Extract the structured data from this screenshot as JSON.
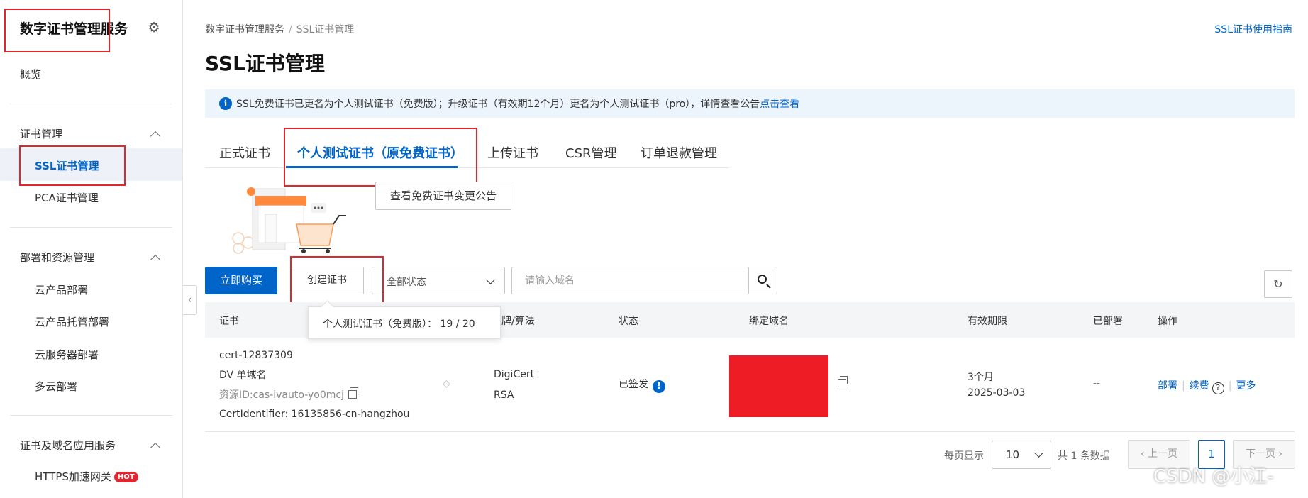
{
  "sidebar": {
    "app_title": "数字证书管理服务",
    "overview": "概览",
    "groups": [
      {
        "title": "证书管理",
        "items": [
          "SSL证书管理",
          "PCA证书管理"
        ]
      },
      {
        "title": "部署和资源管理",
        "items": [
          "云产品部署",
          "云产品托管部署",
          "云服务器部署",
          "多云部署"
        ]
      },
      {
        "title": "证书及域名应用服务",
        "items": [
          "HTTPS加速网关"
        ]
      }
    ],
    "hot_badge": "HOT",
    "active_item": "SSL证书管理"
  },
  "breadcrumb": {
    "root": "数字证书管理服务",
    "sep": "/",
    "current": "SSL证书管理"
  },
  "guide_link": "SSL证书使用指南",
  "page_title": "SSL证书管理",
  "notice": {
    "text": "SSL免费证书已更名为个人测试证书（免费版）；升级证书（有效期12个月）更名为个人测试证书（pro），详情查看公告",
    "link": "点击查看"
  },
  "tabs": [
    "正式证书",
    "个人测试证书（原免费证书）",
    "上传证书",
    "CSR管理",
    "订单退款管理"
  ],
  "active_tab": "个人测试证书（原免费证书）",
  "announce_button": "查看免费证书变更公告",
  "toolbar": {
    "buy": "立即购买",
    "create": "创建证书",
    "status_selected": "全部状态",
    "search_placeholder": "请输入域名"
  },
  "tooltip": "个人测试证书（免费版）：  19 / 20",
  "table": {
    "headers": [
      "证书",
      "品牌/算法",
      "状态",
      "绑定域名",
      "有效期限",
      "已部署",
      "操作"
    ],
    "rows": [
      {
        "cert_id": "cert-12837309",
        "cert_type": "DV 单域名",
        "resource_id": "资源ID:cas-ivauto-yo0mcj",
        "cert_identifier": "CertIdentifier: 16135856-cn-hangzhou",
        "brand": "DigiCert",
        "algorithm": "RSA",
        "status": "已签发",
        "validity": "3个月",
        "expiry": "2025-03-03",
        "deployed": "--",
        "actions": [
          "部署",
          "续费",
          "更多"
        ]
      }
    ]
  },
  "pagination": {
    "per_page_label": "每页显示",
    "per_page": "10",
    "total": "共 1 条数据",
    "prev": "上一页",
    "page": "1",
    "next": "下一页"
  },
  "watermark": "CSDN @小江-",
  "colors": {
    "accent": "#0064c8",
    "annotation_red": "#e0262f",
    "redacted": "#ee1c24"
  }
}
